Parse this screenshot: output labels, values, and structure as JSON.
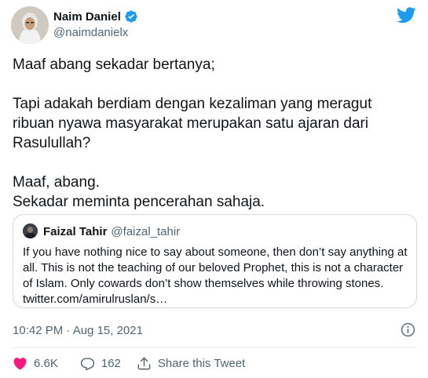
{
  "author": {
    "name": "Naim Daniel",
    "handle": "@naimdanielx"
  },
  "tweet": {
    "paragraphs": [
      "Maaf abang sekadar bertanya;",
      "Tapi adakah berdiam dengan kezaliman yang meragut ribuan nyawa masyarakat merupakan satu ajaran dari Rasulullah?",
      "Maaf, abang.",
      "Sekadar meminta pencerahan sahaja."
    ]
  },
  "quote": {
    "name": "Faizal Tahir",
    "handle": "@faizal_tahir",
    "text": "If you have nothing nice to say about someone, then don’t say anything at all. This is not the teaching of our beloved Prophet, this is not a character of Islam. Only cowards don’t show themselves while throwing stones. twitter.com/amirulruslan/s…"
  },
  "meta": {
    "timestamp": "10:42 PM · Aug 15, 2021"
  },
  "actions": {
    "likes": "6.6K",
    "replies": "162",
    "share_label": "Share this Tweet"
  },
  "colors": {
    "brand": "#1d9bf0",
    "like": "#f91880",
    "text_secondary": "#536471"
  }
}
